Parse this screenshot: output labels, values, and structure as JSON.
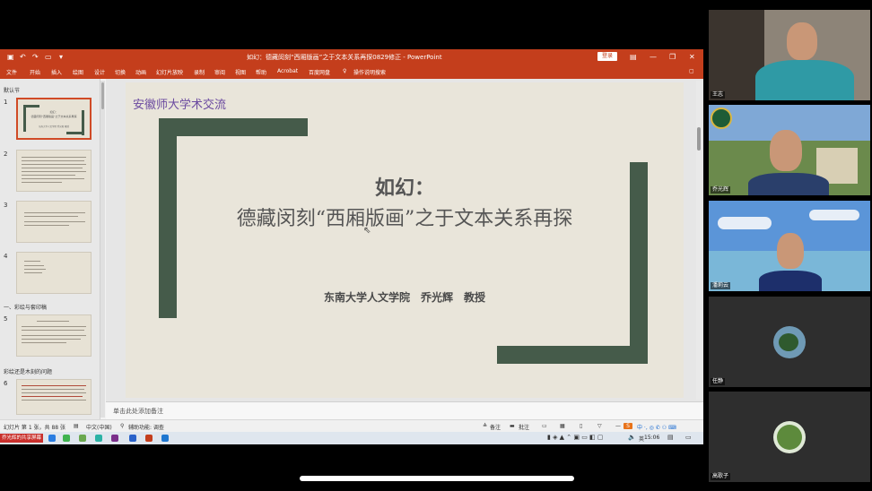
{
  "window": {
    "title": "如幻：德藏闵刻“西厢版画”之于文本关系再探0829修正 - PowerPoint",
    "login_label": "登录"
  },
  "ribbon": {
    "tabs": [
      "文件",
      "开始",
      "插入",
      "绘图",
      "设计",
      "切换",
      "动画",
      "幻灯片放映",
      "录制",
      "审阅",
      "视图",
      "帮助",
      "Acrobat",
      "百度网盘"
    ],
    "tell_me": "操作说明搜索"
  },
  "thumbnails": {
    "section_default": "默认节",
    "section_1": "一、彩绘与套印稿",
    "section_2": "彩绘还是木刻的问题",
    "slides": [
      "1",
      "2",
      "3",
      "4",
      "5",
      "6"
    ],
    "slide1_preview_title": "如幻：",
    "slide1_preview_subtitle": "德藏闵刻“西厢版画”之于文本关系再探",
    "slide1_preview_author": "东南大学人文学院 乔光辉 教授"
  },
  "slide": {
    "header": "安徽师大学术交流",
    "title_line1": "如幻：",
    "title_line2": "德藏闵刻“西厢版画”之于文本关系再探",
    "author": "东南大学人文学院　乔光辉　教授",
    "accent_color": "#455b4a",
    "header_color": "#6b4aa0"
  },
  "notes": {
    "placeholder": "单击此处添加备注"
  },
  "statusbar": {
    "slide_info": "幻灯片 第 1 张，共 88 张",
    "language": "中文(中国)",
    "accessibility": "辅助功能: 调查",
    "notes_btn": "备注",
    "comments_btn": "批注"
  },
  "taskbar": {
    "left_label": "乔光辉的共享屏幕",
    "time": "15:06",
    "ime": "英"
  },
  "participants": [
    {
      "name": "王志",
      "bg": "#6d6358"
    },
    {
      "name": "乔光辉",
      "bg": "#8fb3d6"
    },
    {
      "name": "潘莉云",
      "bg": "#5b95d8"
    },
    {
      "name": "任静",
      "bg": "#2d2d2d"
    },
    {
      "name": "高歌子",
      "bg": "#2d2d2d"
    }
  ]
}
